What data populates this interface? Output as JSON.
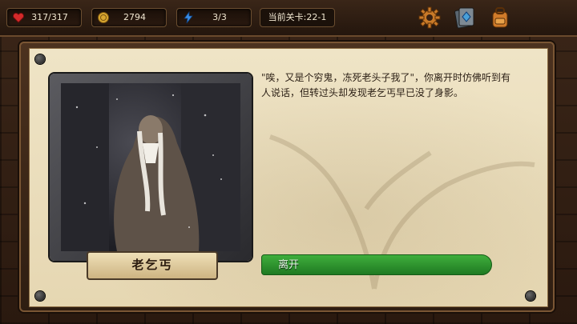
{
  "stats": {
    "hp": "317/317",
    "gold": "2794",
    "energy": "3/3",
    "level": "当前关卡:22-1"
  },
  "toolbar": {
    "settings_icon": "gear-icon",
    "cards_icon": "card-deck-icon",
    "backpack_icon": "backpack-icon"
  },
  "event": {
    "name": "老乞丐",
    "text": "\"唉，又是个穷鬼，冻死老头子我了\"，你离开时仿佛听到有人说话，但转过头却发现老乞丐早已没了身影。",
    "leave_label": "离开"
  },
  "colors": {
    "hp": "#d42a2a",
    "gold": "#d8a630",
    "energy": "#3a8ee8",
    "button": "#2f9a32"
  }
}
